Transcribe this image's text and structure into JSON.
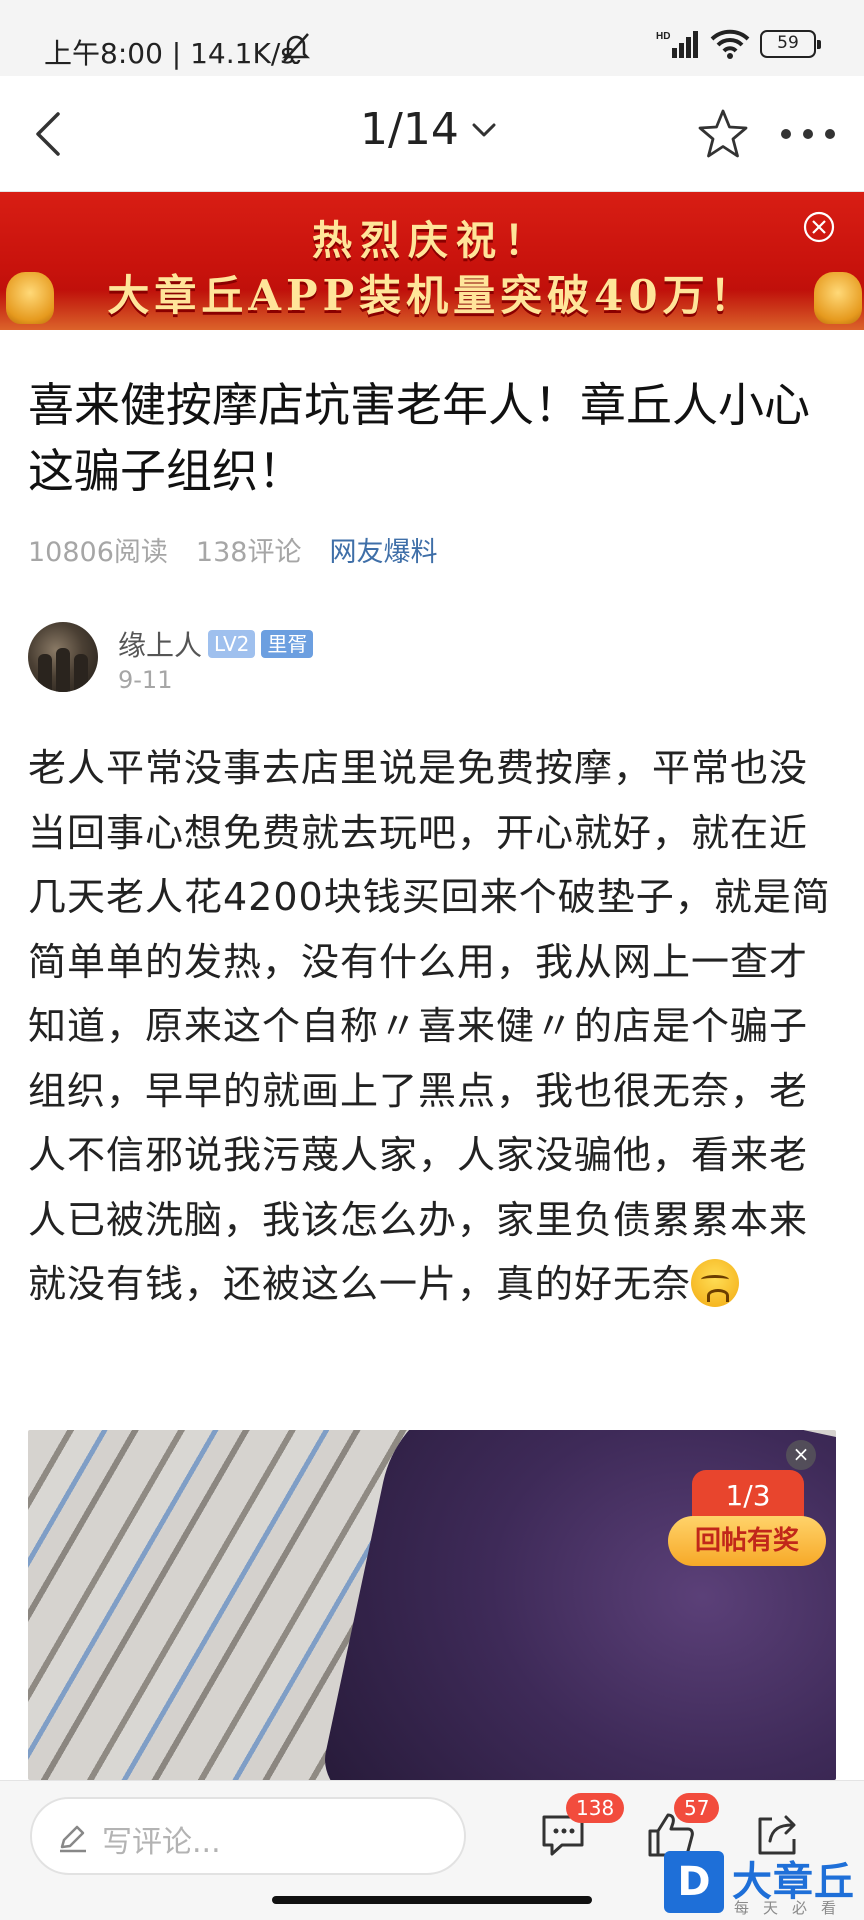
{
  "status_bar": {
    "time": "上午8:00 | 14.1K/s",
    "battery": "59",
    "icons": [
      "bell-off-icon",
      "signal-icon",
      "wifi-icon",
      "battery-icon"
    ]
  },
  "nav": {
    "pager": "1/14",
    "icons": [
      "back-icon",
      "chevron-down-icon",
      "star-icon",
      "more-icon"
    ]
  },
  "banner": {
    "line1": "热烈庆祝！",
    "line2": "大章丘APP装机量突破40万！"
  },
  "article": {
    "title": "喜来健按摩店坑害老年人！章丘人小心这骗子组织！",
    "reads": "10806阅读",
    "comments": "138评论",
    "category": "网友爆料"
  },
  "author": {
    "name": "缘上人",
    "level": "LV2",
    "location": "里胥",
    "date": "9-11"
  },
  "body": "老人平常没事去店里说是免费按摩，平常也没当回事心想免费就去玩吧，开心就好，就在近几天老人花4200块钱买回来个破垫子，就是简简单单的发热，没有什么用，我从网上一查才知道，原来这个自称〃喜来健〃的店是个骗子组织，早早的就画上了黑点，我也很无奈，老人不信邪说我污蔑人家，人家没骗他，看来老人已被洗脑，我该怎么办，家里负债累累本来就没有钱，还被这么一片，真的好无奈",
  "photo": {
    "counter": "1/3",
    "reward": "回帖有奖",
    "close": "×"
  },
  "toolbar": {
    "comment_placeholder": "写评论...",
    "comment_count": "138",
    "like_count": "57"
  },
  "logo": {
    "letter": "D",
    "name": "大章丘",
    "slogan": "每天必看"
  },
  "colors": {
    "banner_red": "#c8120c",
    "link_blue": "#3f6fa8",
    "badge_red": "#f24c3d",
    "brand_blue": "#1e6fd8"
  }
}
